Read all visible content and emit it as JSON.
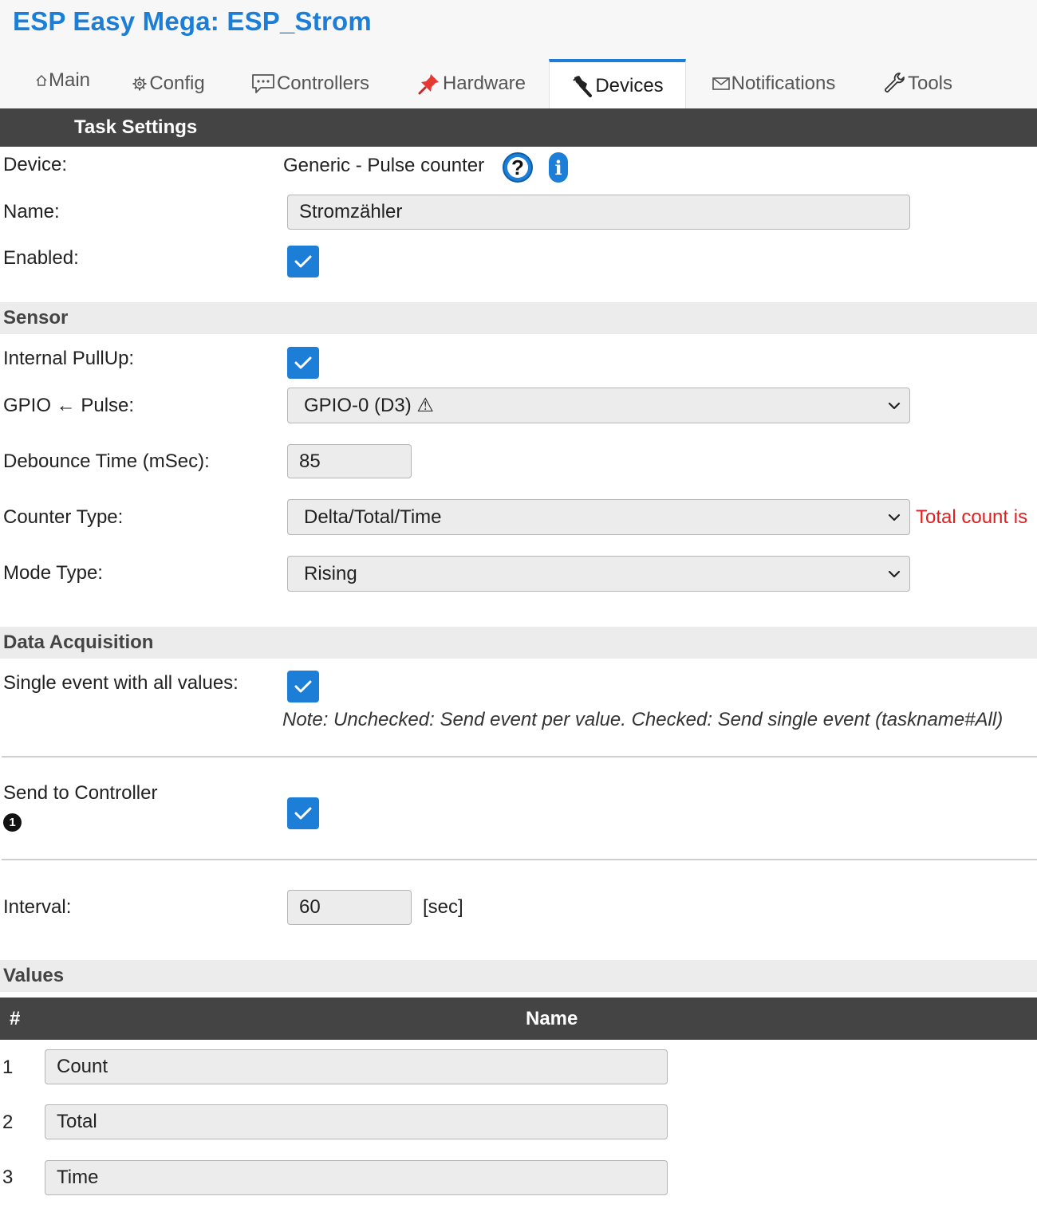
{
  "header": {
    "title": "ESP Easy Mega: ESP_Strom",
    "tabs": [
      {
        "label": "Main",
        "icon": "home-icon"
      },
      {
        "label": "Config",
        "icon": "gear-icon"
      },
      {
        "label": "Controllers",
        "icon": "chat-icon"
      },
      {
        "label": "Hardware",
        "icon": "pushpin-icon"
      },
      {
        "label": "Devices",
        "icon": "plug-icon",
        "active": true
      },
      {
        "label": "Notifications",
        "icon": "envelope-icon"
      },
      {
        "label": "Tools",
        "icon": "wrench-icon"
      }
    ]
  },
  "task_settings": {
    "title": "Task Settings",
    "device_label": "Device:",
    "device_value": "Generic - Pulse counter",
    "help_icon_char": "?",
    "info_icon_char": "i",
    "name_label": "Name:",
    "name_value": "Stromzähler",
    "enabled_label": "Enabled:",
    "enabled": true
  },
  "sensor": {
    "title": "Sensor",
    "pullup_label": "Internal PullUp:",
    "pullup": true,
    "gpio_label": "GPIO ← Pulse:",
    "gpio_value": "GPIO-0 (D3) ⚠",
    "debounce_label": "Debounce Time (mSec):",
    "debounce_value": "85",
    "counter_type_label": "Counter Type:",
    "counter_type_value": "Delta/Total/Time",
    "counter_warning": "Total count is",
    "mode_type_label": "Mode Type:",
    "mode_type_value": "Rising"
  },
  "data_acquisition": {
    "title": "Data Acquisition",
    "single_event_label": "Single event with all values:",
    "single_event": true,
    "note": "Note: Unchecked: Send event per value. Checked: Send single event (taskname#All)",
    "send_controller_label": "Send to Controller",
    "controller_badge": "1",
    "send_controller": true,
    "interval_label": "Interval:",
    "interval_value": "60",
    "interval_unit": "[sec]"
  },
  "values": {
    "title": "Values",
    "col_num": "#",
    "col_name": "Name",
    "rows": [
      {
        "num": "1",
        "name": "Count"
      },
      {
        "num": "2",
        "name": "Total"
      },
      {
        "num": "3",
        "name": "Time"
      }
    ]
  },
  "colors": {
    "accent": "#1c7ed6",
    "dark_bar": "#444444",
    "section_bg": "#ececec",
    "warning": "#e02020"
  }
}
